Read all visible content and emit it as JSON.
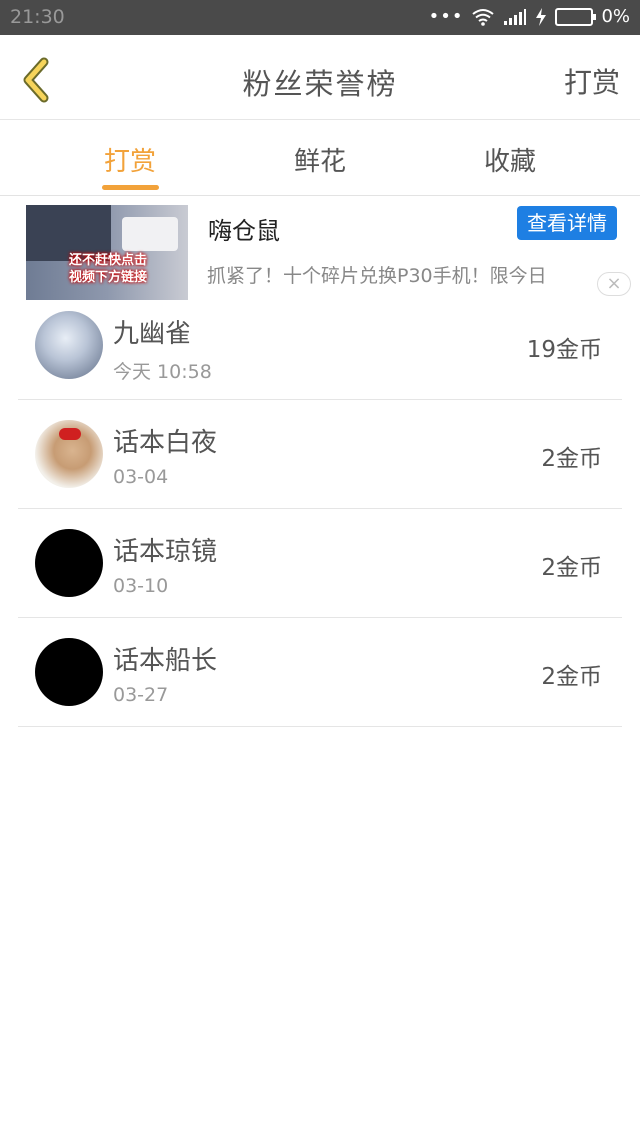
{
  "status_bar": {
    "time": "21:30",
    "battery": "0%"
  },
  "header": {
    "title": "粉丝荣誉榜",
    "action": "打赏"
  },
  "tabs": [
    {
      "label": "打赏",
      "active": true
    },
    {
      "label": "鲜花",
      "active": false
    },
    {
      "label": "收藏",
      "active": false
    }
  ],
  "ad": {
    "name": "嗨仓鼠",
    "button": "查看详情",
    "description": "抓紧了！十个碎片兑换P30手机！限今日",
    "image_caption_1": "还不赶快点击",
    "image_caption_2": "视频下方链接",
    "close": "×"
  },
  "ranking": [
    {
      "name": "九幽雀",
      "time": "今天 10:58",
      "amount": "19金币"
    },
    {
      "name": "话本白夜",
      "time": "03-04",
      "amount": "2金币"
    },
    {
      "name": "话本琼镜",
      "time": "03-10",
      "amount": "2金币"
    },
    {
      "name": "话本船长",
      "time": "03-27",
      "amount": "2金币"
    }
  ],
  "colors": {
    "accent": "#f2a23a",
    "ad_button": "#1e7fe3",
    "status_bar": "#4a4a4a"
  }
}
